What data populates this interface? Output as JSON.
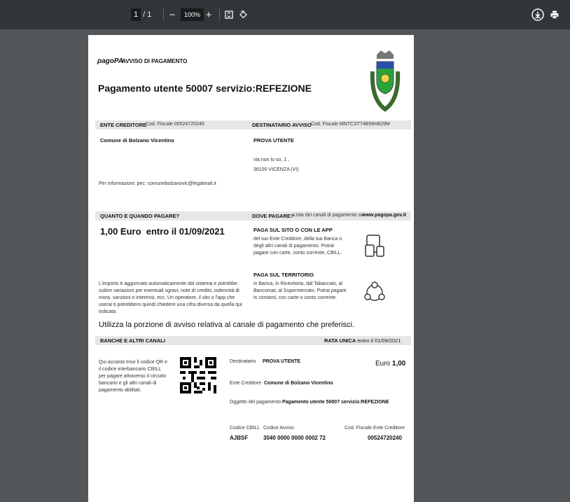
{
  "toolbar": {
    "page_current": "1",
    "page_sep": "/",
    "page_total": "1",
    "zoom_out": "−",
    "zoom_level": "100%",
    "zoom_in": "+",
    "download_icon": "download-icon",
    "print_icon": "print-icon"
  },
  "doc": {
    "logo_text": "pagoPA",
    "header_title": "AVVISO DI PAGAMENTO",
    "main_title": "Pagamento utente 50007 servizio:REFEZIONE",
    "creditor": {
      "heading": "ENTE CREDITORE",
      "cf_label": "Cod. Fiscale 00524720240",
      "name": "Comune di Bolzano Vicentino",
      "info": "Per informazioni: pec: comunebolzanovic@legalmail.it"
    },
    "recipient": {
      "heading": "DESTINATARIO AVVISO",
      "cf_label": "Cod. Fiscale MNTCST74B56H829M",
      "name": "PROVA UTENTE",
      "address1": "via non lo so, 1 ,",
      "address2": "36100 VICENZA (VI)"
    },
    "how_much": {
      "heading": "QUANTO E QUANDO PAGARE?",
      "amount_line": "1,00 Euro  entro il 01/09/2021",
      "note": "L'importo è aggiornato automaticamente dal sistema e potrebbe subire variazioni per eventuali sgravi, note di credito, indennità di mora, sanzioni o interessi, ecc. Un operatore, il sito o l'app che userai ti potrebbero quindi chiedere una cifra diversa da quella qui indicata."
    },
    "where": {
      "heading": "DOVE PAGARE?",
      "subheading": "Lista dei canali di pagamento su",
      "site": "www.pagopa.gov.it",
      "online_title": "PAGA SUL SITO O CON LE APP",
      "online_text": "del tuo Ente Creditore, della tua Banca o degli altri canali di pagamento. Potrai pagare con carte, conto corrente, CBILL.",
      "local_title": "PAGA SUL TERRITORIO",
      "local_text": "in Banca, in Ricevitoria, dal Tabaccaio, al Bancomat, al Supermercato. Potrai pagare in contanti, con carte o conto corrente."
    },
    "use_portion": "Utilizza la porzione di avviso relativa al canale di pagamento che preferisci.",
    "bank": {
      "heading": "BANCHE E ALTRI CANALI",
      "rata_label": "RATA UNICA",
      "rata_date": "entro il 01/09/2021",
      "qr_text": "Qui accanto trovi il codice QR e il codice interbancario CBILL per pagare attraverso il circuito bancario e gli altri canali di pagamento abilitati.",
      "dest_label": "Destinatario",
      "dest_value": "PROVA UTENTE",
      "euro_label": "Euro",
      "euro_value": "1,00",
      "ente_label": "Ente Creditore",
      "ente_value": "Comune di Bolzano Vicentino",
      "oggetto_label": "Oggetto del pagamento",
      "oggetto_value": "Pagamento utente 50007 servizio:REFEZIONE",
      "cbill_label": "Codice CBILL",
      "cbill_value": "AJBSF",
      "avviso_label": "Codice Avviso",
      "avviso_value": "3040 0000 0000 0002 72",
      "cf_label": "Cod. Fiscale Ente Creditore",
      "cf_value": "00524720240"
    }
  },
  "colors": {
    "toolbar_bg": "#323639",
    "viewer_bg": "#525659",
    "band": "#e6e6e6"
  }
}
